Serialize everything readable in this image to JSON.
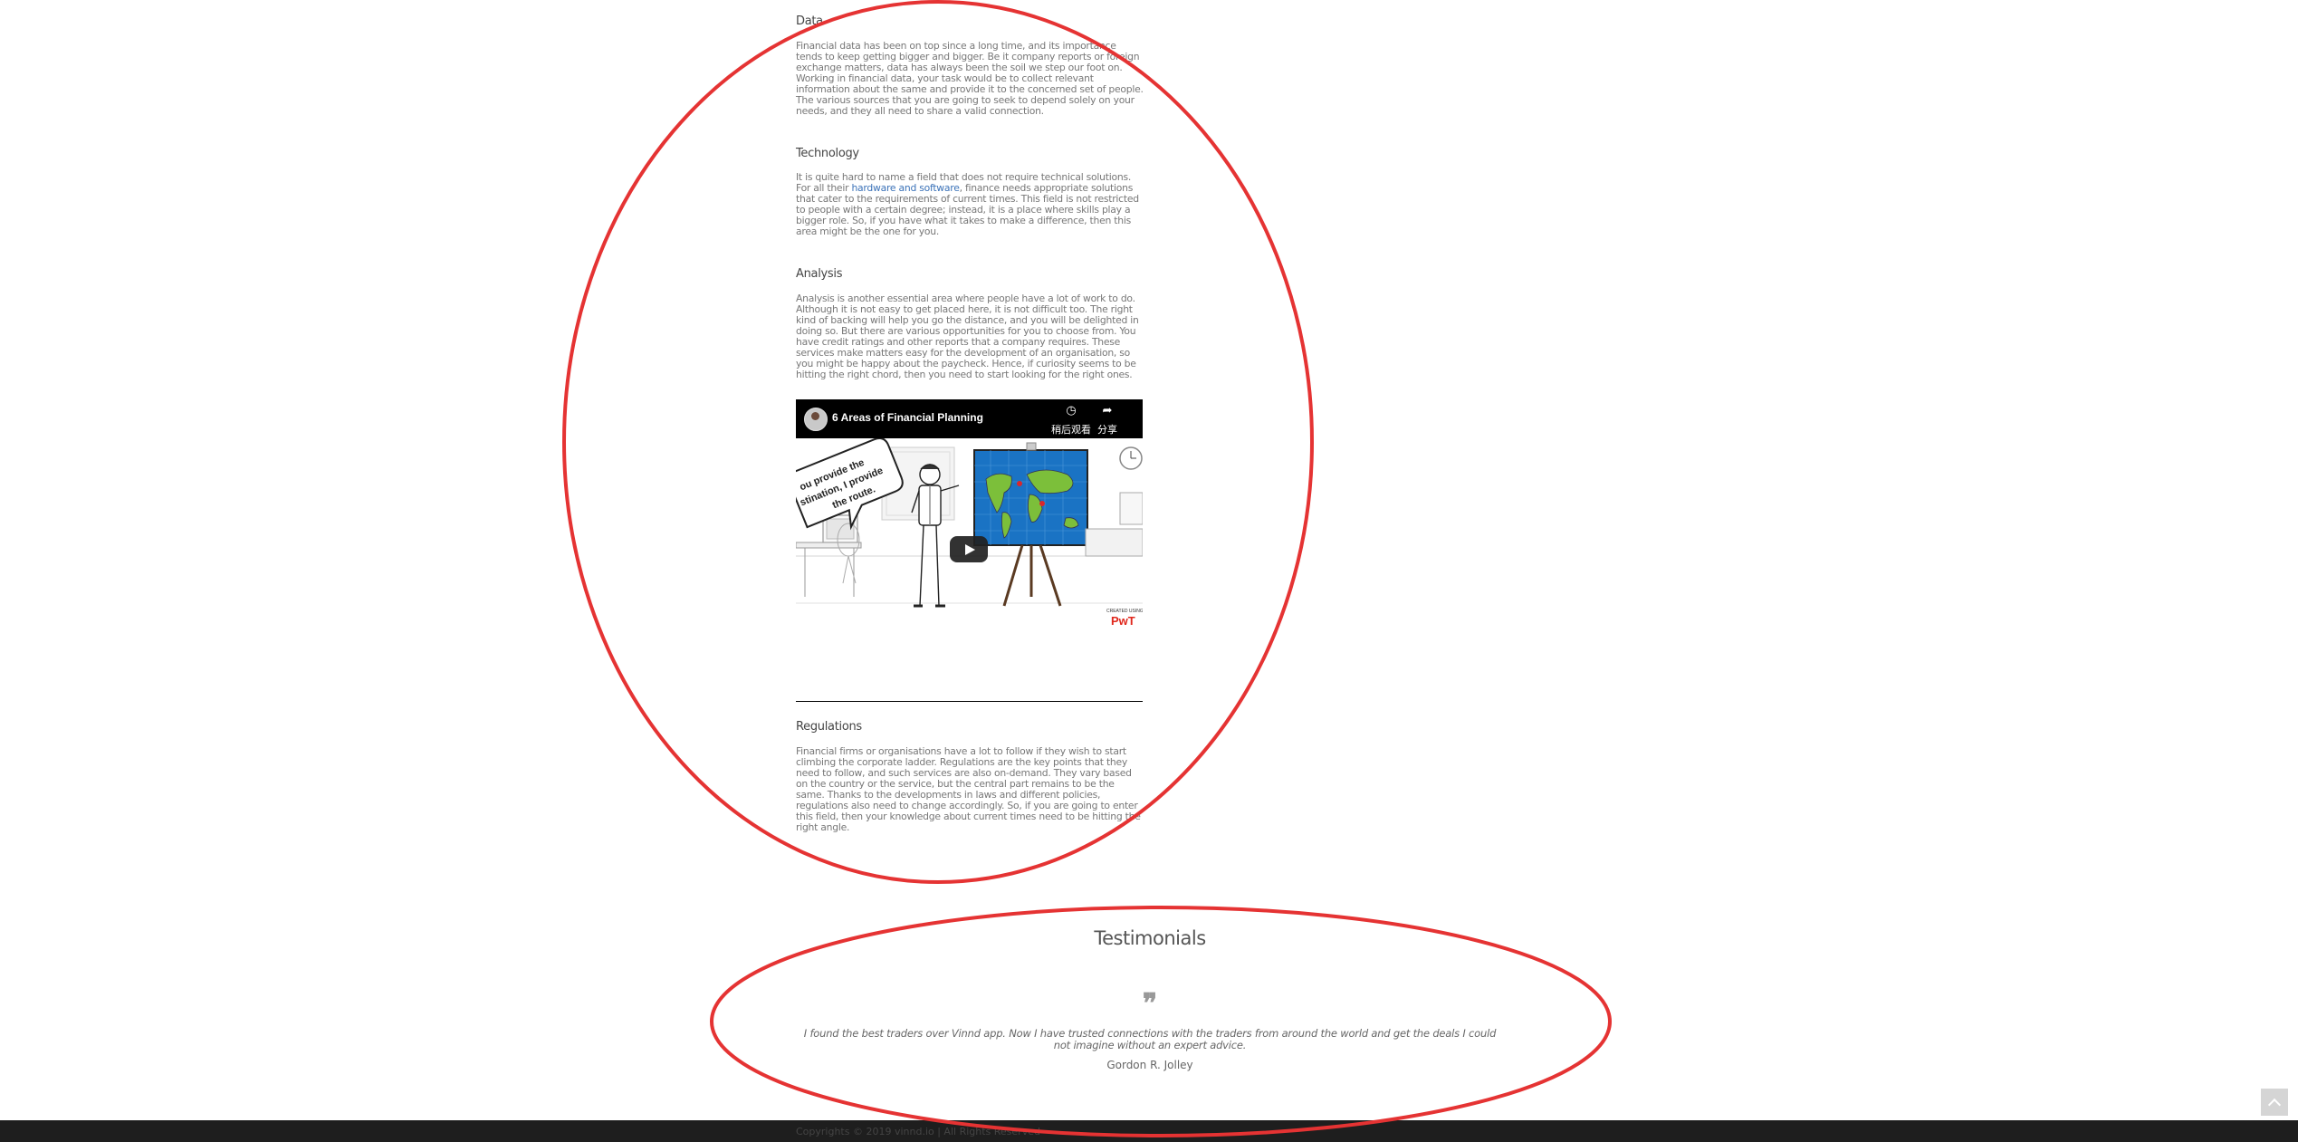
{
  "sections": [
    {
      "title": "Data",
      "text": "Financial data has been on top since a long time, and its importance tends to keep getting bigger and bigger. Be it company reports or foreign exchange matters, data has always been the soil we step our foot on. Working in financial data, your task would be to collect relevant information about the same and provide it to the concerned set of people. The various sources that you are going to seek to depend solely on your needs, and they all need to share a valid connection."
    },
    {
      "title": "Technology",
      "text_before_link": "It is quite hard to name a field that does not require technical solutions. For all their ",
      "link": "hardware and software",
      "text_after_link": ", finance needs appropriate solutions that cater to the requirements of current times. This field is not restricted to people with a certain degree; instead, it is a place where skills play a bigger role. So, if you have what it takes to make a difference, then this area might be the one for you."
    },
    {
      "title": "Analysis",
      "text": "Analysis is another essential area where people have a lot of work to do. Although it is not easy to get placed here, it is not difficult too. The right kind of backing will help you go the distance, and you will be delighted in doing so. But there are various opportunities for you to choose from. You have credit ratings and other reports that a company requires. These services make matters easy for the development of an organisation, so you might be happy about the paycheck. Hence, if curiosity seems to be hitting the right chord, then you need to start looking for the right ones."
    },
    {
      "title": "Regulations",
      "text": "Financial firms or organisations have a lot to follow if they wish to start climbing the corporate ladder. Regulations are the key points that they need to follow, and such services are also on-demand. They vary based on the country or the service, but the central part remains to be the same. Thanks to the developments in laws and different policies, regulations also need to change accordingly. So, if you are going to enter this field, then your knowledge about current times need to be hitting the right angle."
    }
  ],
  "video": {
    "title": "6 Areas of Financial Planning",
    "watch_later_label": "稍后观看",
    "share_label": "分享",
    "speech_bubble": "...ou provide the ...stination, I provide the route.",
    "watermark": "CREATED USING PowToon"
  },
  "testimonials": {
    "title": "Testimonials",
    "quote_mark": "❞",
    "quote": "I found the best traders over Vinnd app. Now I have trusted connections with the traders from around the world and get the deals I could not imagine without an expert advice.",
    "author": "Gordon R. Jolley"
  },
  "footer": {
    "copyright": "Copyrights © 2019 vinnd.io  |  All Rights Reserved"
  },
  "icons": {
    "scroll_top": "chevron-up-icon",
    "watch_later": "clock-icon",
    "share": "share-arrow-icon",
    "play": "play-icon"
  },
  "colors": {
    "link": "#3b72b8",
    "annotation": "#e53333",
    "footer_bg": "#1e1e1e"
  }
}
